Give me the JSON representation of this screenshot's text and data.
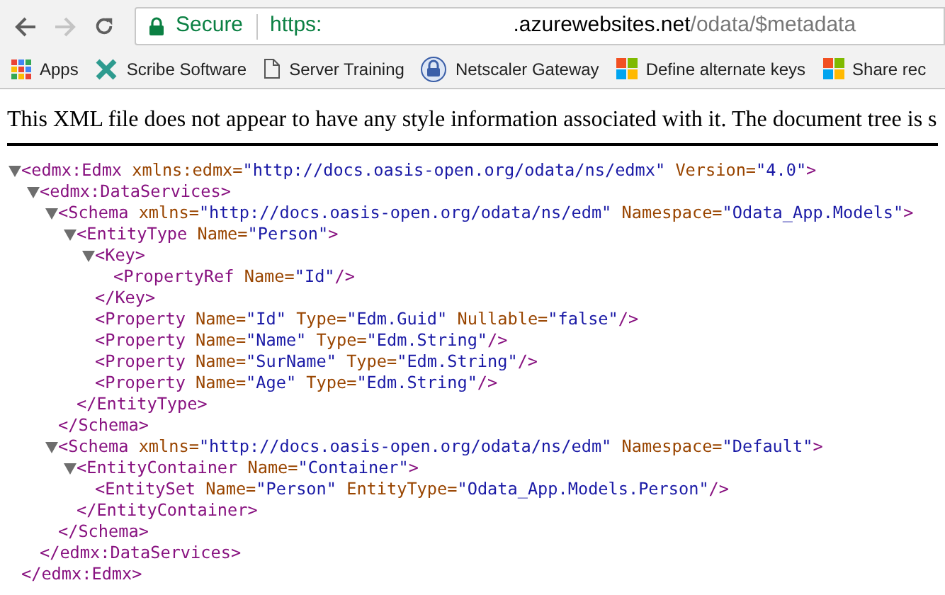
{
  "toolbar": {
    "security_label": "Secure",
    "url_scheme": "https:",
    "url_host": ".azurewebsites.net",
    "url_path": "/odata/$metadata"
  },
  "bookmarks": [
    {
      "kind": "apps",
      "label": "Apps"
    },
    {
      "kind": "scribe",
      "label": "Scribe Software"
    },
    {
      "kind": "page",
      "label": "Server Training"
    },
    {
      "kind": "lock",
      "label": "Netscaler Gateway"
    },
    {
      "kind": "windows",
      "label": "Define alternate keys"
    },
    {
      "kind": "windows",
      "label": "Share rec"
    }
  ],
  "notice": "This XML file does not appear to have any style information associated with it. The document tree is s",
  "xml_tree": [
    {
      "open": "<edmx:Edmx",
      "attrs": [
        {
          "name": "xmlns:edmx=",
          "value": "\"http://docs.oasis-open.org/odata/ns/edmx\""
        },
        {
          "name": "Version=",
          "value": "\"4.0\""
        }
      ],
      "end": ">",
      "expanded": true,
      "close": "</edmx:Edmx>",
      "children": [
        {
          "open": "<edmx:DataServices",
          "end": ">",
          "expanded": true,
          "close": "</edmx:DataServices>",
          "children": [
            {
              "open": "<Schema",
              "attrs": [
                {
                  "name": "xmlns=",
                  "value": "\"http://docs.oasis-open.org/odata/ns/edm\""
                },
                {
                  "name": "Namespace=",
                  "value": "\"Odata_App.Models\""
                }
              ],
              "end": ">",
              "expanded": true,
              "close": "</Schema>",
              "children": [
                {
                  "open": "<EntityType",
                  "attrs": [
                    {
                      "name": "Name=",
                      "value": "\"Person\""
                    }
                  ],
                  "end": ">",
                  "expanded": true,
                  "close": "</EntityType>",
                  "children": [
                    {
                      "open": "<Key",
                      "end": ">",
                      "expanded": true,
                      "close": "</Key>",
                      "children": [
                        {
                          "open": "<PropertyRef",
                          "attrs": [
                            {
                              "name": "Name=",
                              "value": "\"Id\""
                            }
                          ],
                          "end": "/>"
                        }
                      ]
                    },
                    {
                      "open": "<Property",
                      "attrs": [
                        {
                          "name": "Name=",
                          "value": "\"Id\""
                        },
                        {
                          "name": "Type=",
                          "value": "\"Edm.Guid\""
                        },
                        {
                          "name": "Nullable=",
                          "value": "\"false\""
                        }
                      ],
                      "end": "/>"
                    },
                    {
                      "open": "<Property",
                      "attrs": [
                        {
                          "name": "Name=",
                          "value": "\"Name\""
                        },
                        {
                          "name": "Type=",
                          "value": "\"Edm.String\""
                        }
                      ],
                      "end": "/>"
                    },
                    {
                      "open": "<Property",
                      "attrs": [
                        {
                          "name": "Name=",
                          "value": "\"SurName\""
                        },
                        {
                          "name": "Type=",
                          "value": "\"Edm.String\""
                        }
                      ],
                      "end": "/>"
                    },
                    {
                      "open": "<Property",
                      "attrs": [
                        {
                          "name": "Name=",
                          "value": "\"Age\""
                        },
                        {
                          "name": "Type=",
                          "value": "\"Edm.String\""
                        }
                      ],
                      "end": "/>"
                    }
                  ]
                }
              ]
            },
            {
              "open": "<Schema",
              "attrs": [
                {
                  "name": "xmlns=",
                  "value": "\"http://docs.oasis-open.org/odata/ns/edm\""
                },
                {
                  "name": "Namespace=",
                  "value": "\"Default\""
                }
              ],
              "end": ">",
              "expanded": true,
              "close": "</Schema>",
              "children": [
                {
                  "open": "<EntityContainer",
                  "attrs": [
                    {
                      "name": "Name=",
                      "value": "\"Container\""
                    }
                  ],
                  "end": ">",
                  "expanded": true,
                  "close": "</EntityContainer>",
                  "children": [
                    {
                      "open": "<EntitySet",
                      "attrs": [
                        {
                          "name": "Name=",
                          "value": "\"Person\""
                        },
                        {
                          "name": "EntityType=",
                          "value": "\"Odata_App.Models.Person\""
                        }
                      ],
                      "end": "/>"
                    }
                  ]
                }
              ]
            }
          ]
        }
      ]
    }
  ]
}
